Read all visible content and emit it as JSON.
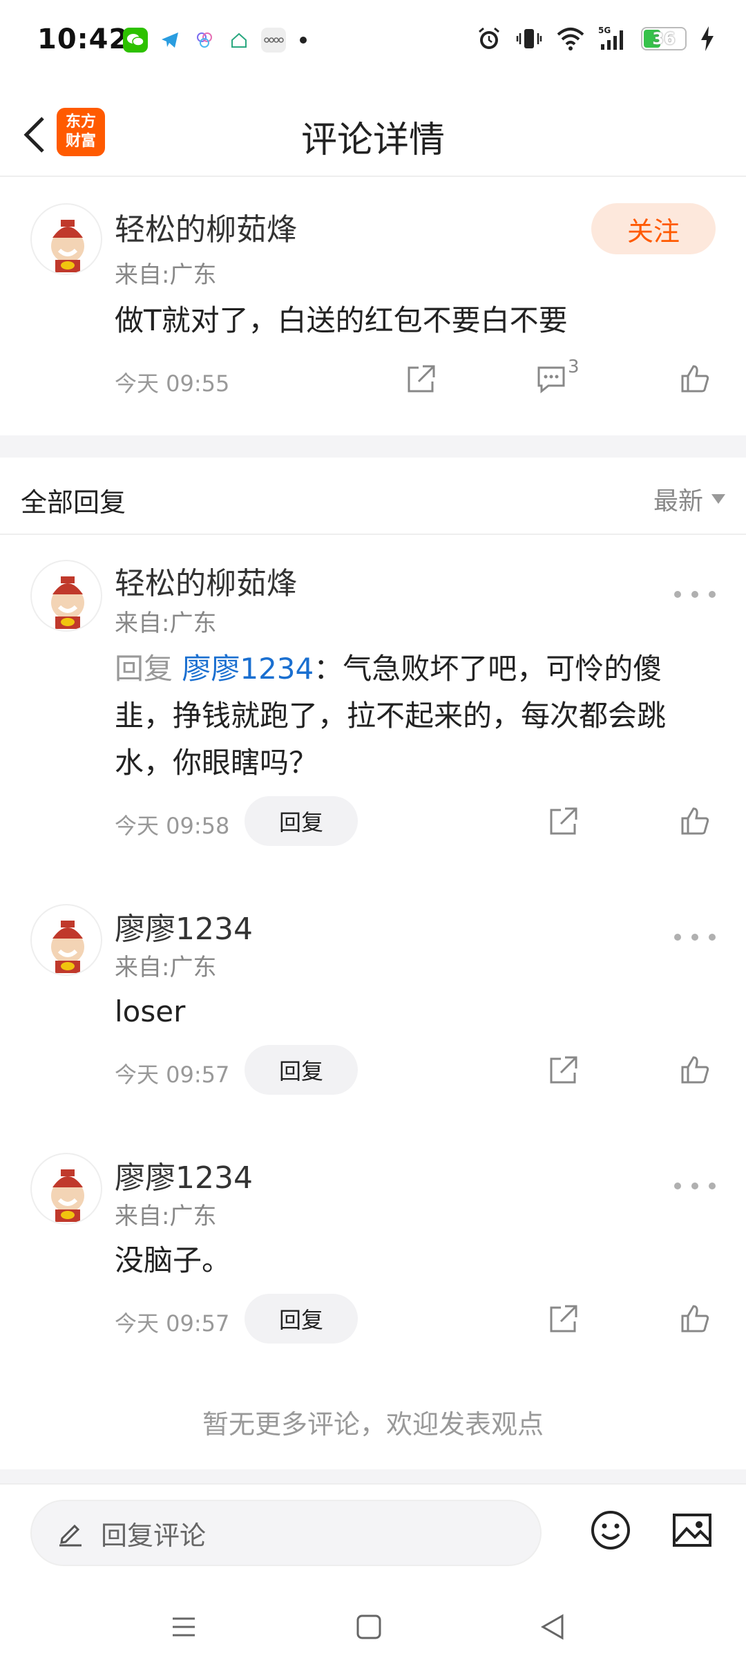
{
  "status_bar": {
    "time": "10:42",
    "battery": "36",
    "network": "5G"
  },
  "header": {
    "logo_text_line1": "东方",
    "logo_text_line2": "财富",
    "title": "评论详情"
  },
  "main_comment": {
    "author": "轻松的柳茹烽",
    "location": "来自:广东",
    "content": "做T就对了，白送的红包不要白不要",
    "time": "今天 09:55",
    "follow_label": "关注",
    "comment_count": "3"
  },
  "replies_section": {
    "title": "全部回复",
    "sort_label": "最新"
  },
  "replies": [
    {
      "author": "轻松的柳茹烽",
      "location": "来自:广东",
      "reply_prefix": "回复 ",
      "mention": "廖廖1234",
      "content": "：气急败坏了吧，可怜的傻韭，挣钱就跑了，拉不起来的，每次都会跳水，你眼瞎吗？",
      "time": "今天 09:58",
      "reply_label": "回复"
    },
    {
      "author": "廖廖1234",
      "location": "来自:广东",
      "content": "loser",
      "time": "今天 09:57",
      "reply_label": "回复"
    },
    {
      "author": "廖廖1234",
      "location": "来自:广东",
      "content": "没脑子。",
      "time": "今天 09:57",
      "reply_label": "回复"
    }
  ],
  "footer_note": "暂无更多评论，欢迎发表观点",
  "input": {
    "placeholder": "回复评论"
  },
  "colors": {
    "accent": "#ff5a00",
    "mention": "#1a6fd0",
    "follow_bg": "#fde8dc"
  }
}
